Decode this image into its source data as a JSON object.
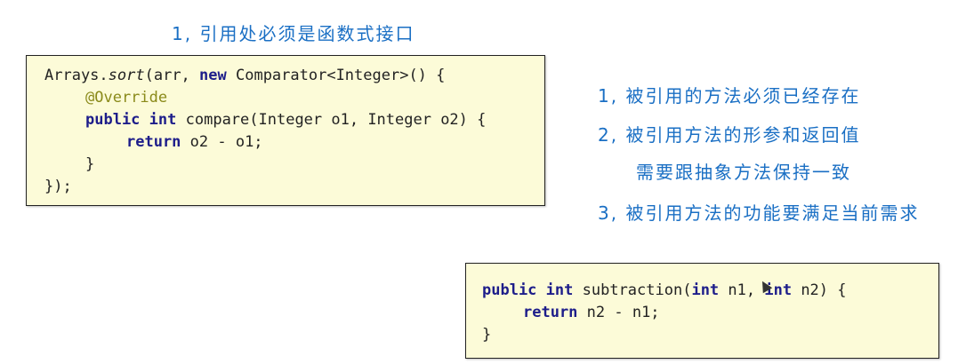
{
  "title": "1, 引用处必须是函数式接口",
  "rules": [
    "1, 被引用的方法必须已经存在",
    "2, 被引用方法的形参和返回值",
    "需要跟抽象方法保持一致",
    "3, 被引用方法的功能要满足当前需求"
  ],
  "code_top": {
    "l1_a": "Arrays.",
    "l1_sort": "sort",
    "l1_b": "(arr, ",
    "l1_new": "new",
    "l1_c": " Comparator<Integer>() {",
    "l2_ann": "@Override",
    "l3_public": "public",
    "l3_int": "int",
    "l3_rest": " compare(Integer o1, Integer o2) {",
    "l4_return": "return",
    "l4_rest": " o2 - o1;",
    "l5": "}",
    "l6": "});"
  },
  "code_bottom": {
    "l1_public": "public",
    "l1_int": "int",
    "l1_mid": " subtraction(",
    "l1_int2": "int",
    "l1_mid2": " n1, ",
    "l1_int3": "int",
    "l1_rest": " n2) {",
    "l2_return": "return",
    "l2_rest": " n2 - n1;",
    "l3": "}"
  },
  "colors": {
    "heading": "#1a6fc4",
    "code_bg": "#fcfbd8",
    "keyword": "#1d1d8a",
    "annotation": "#8a8a1a"
  }
}
